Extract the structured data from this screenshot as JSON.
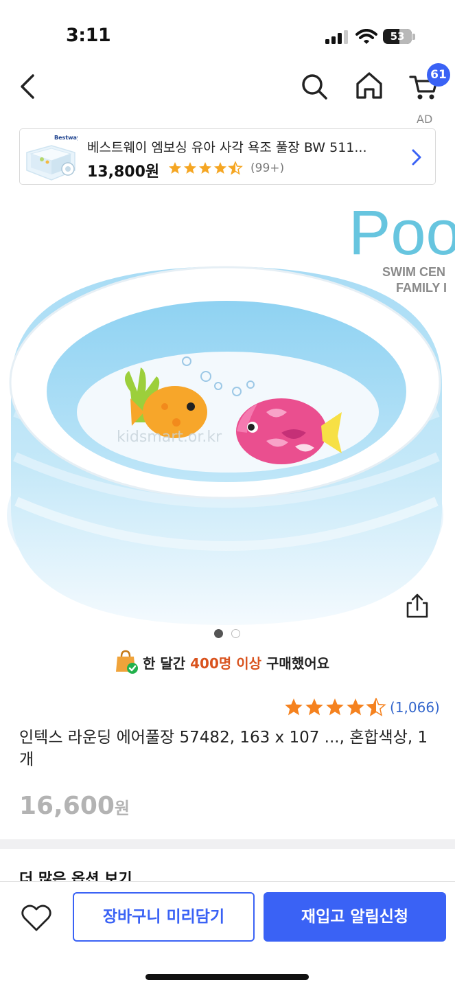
{
  "status_bar": {
    "time": "3:11",
    "battery": "53"
  },
  "nav": {
    "cart_count": "61",
    "ad_label": "AD"
  },
  "ad": {
    "title": "베스트웨이 엠보싱 유아 사각 욕조 풀장 BW 511...",
    "price": "13,800원",
    "rating": 4.5,
    "review_count": "(99+)",
    "thumb_brand": "Bestway"
  },
  "image": {
    "watermark_line1": "Poo",
    "watermark_line2": "SWIM CEN",
    "watermark_line3": "FAMILY I",
    "site_watermark": "kidsmart.or.kr"
  },
  "carousel": {
    "current": 1,
    "total": 2
  },
  "notice": {
    "prefix": "한 달간 ",
    "highlight": "400명 이상",
    "suffix": " 구매했어요"
  },
  "product": {
    "rating": 4.5,
    "review_count": "(1,066)",
    "title": "인텍스 라운딩 에어풀장 57482, 163 x 107 ..., 혼합색상, 1개",
    "price": "16,600",
    "price_unit": "원"
  },
  "section": {
    "more_options": "더 많은 옵션 보기"
  },
  "bottom_bar": {
    "cart_button": "장바구니 미리담기",
    "notify_button": "재입고 알림신청"
  },
  "colors": {
    "accent": "#3a62f5",
    "star": "#f5821f",
    "ad_star": "#f5a623",
    "highlight": "#d9531e",
    "rating_link": "#3366cc"
  }
}
